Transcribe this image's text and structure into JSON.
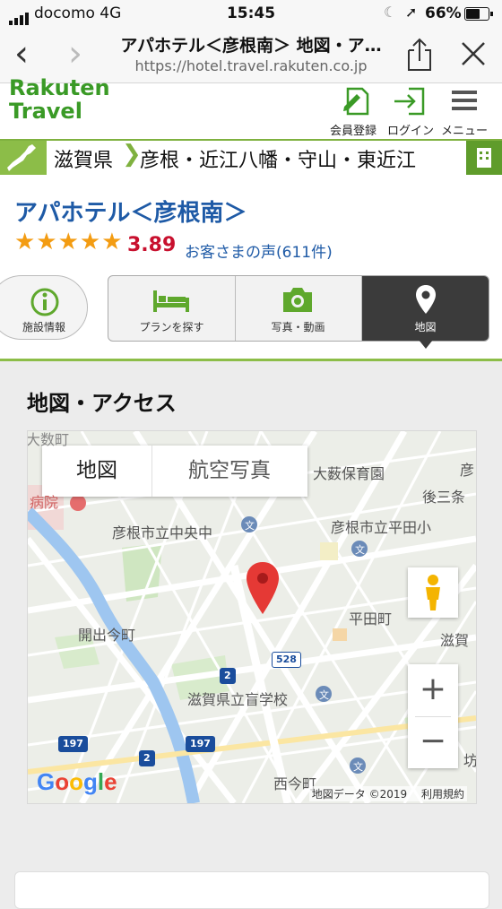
{
  "status": {
    "carrier": "docomo 4G",
    "time": "15:45",
    "battery": "66%"
  },
  "browser": {
    "title": "アパホテル＜彦根南＞ 地図・ア…",
    "url": "https://hotel.travel.rakuten.co.jp"
  },
  "site": {
    "logo_line1": "Rakuten",
    "logo_line2": "Travel",
    "register": "会員登録",
    "login": "ログイン",
    "menu": "メニュー"
  },
  "breadcrumb": {
    "prefecture": "滋賀県",
    "area": "彦根・近江八幡・守山・東近江"
  },
  "hotel": {
    "name": "アパホテル＜彦根南＞",
    "stars": "★★★★★",
    "rating": "3.89",
    "reviews": "お客さまの声(611件)"
  },
  "tabs": {
    "info": "施設情報",
    "plans": "プランを探す",
    "photos": "写真・動画",
    "map": "地図"
  },
  "section": {
    "title": "地図・アクセス"
  },
  "map": {
    "type_map": "地図",
    "type_satellite": "航空写真",
    "labels": {
      "nursery": "大薮保育園",
      "hospital": "病院",
      "school_central": "彦根市立中央中",
      "school_heiden": "彦根市立平田小",
      "gojo": "後三条",
      "hirata": "平田町",
      "kaide": "開出今町",
      "shiga": "滋賀",
      "blind_school": "滋賀県立盲学校",
      "nishi": "西今町",
      "hiko": "彦",
      "bo": "坊",
      "yabu": "大数町"
    },
    "routes": {
      "r528": "528",
      "r2a": "2",
      "r197a": "197",
      "r197b": "197",
      "r2b": "2"
    },
    "zoom_in": "+",
    "zoom_out": "−",
    "google": "Google",
    "attribution": "地図データ ©2019",
    "terms": "利用規約"
  },
  "colors": {
    "brand_green": "#3a9a26",
    "link_blue": "#1e5aa6",
    "rating_red": "#c8102e",
    "star": "#f39c12"
  }
}
